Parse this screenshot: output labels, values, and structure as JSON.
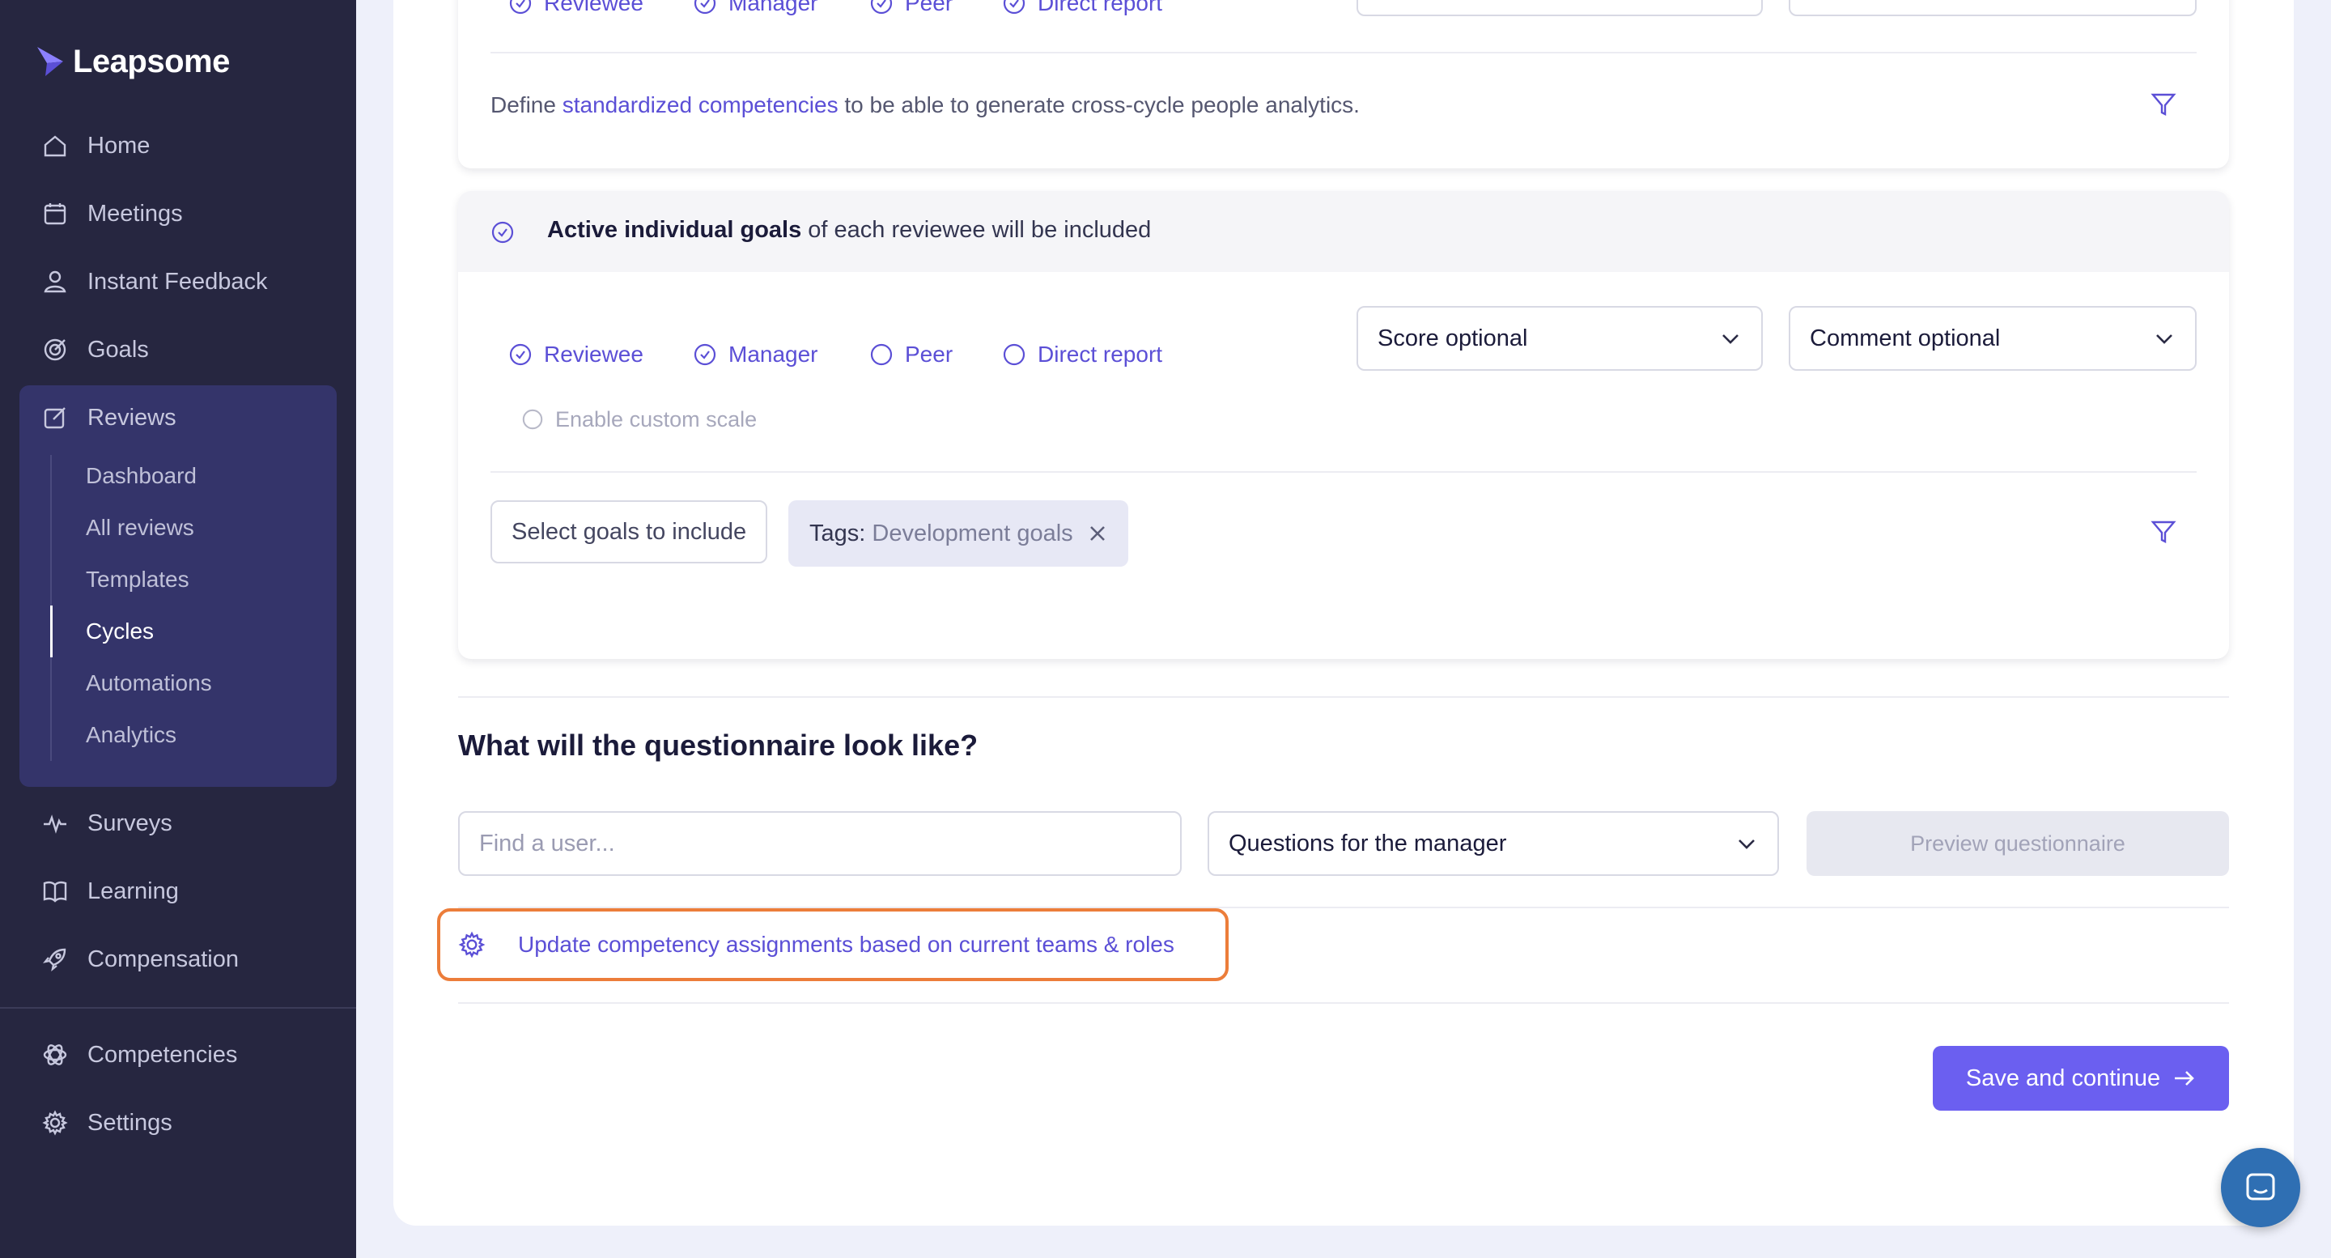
{
  "app": {
    "name": "Leapsome"
  },
  "sidebar": {
    "items": [
      {
        "label": "Home",
        "icon": "home-icon"
      },
      {
        "label": "Meetings",
        "icon": "meetings-icon"
      },
      {
        "label": "Instant Feedback",
        "icon": "feedback-icon"
      },
      {
        "label": "Goals",
        "icon": "target-icon"
      },
      {
        "label": "Reviews",
        "icon": "edit-icon"
      },
      {
        "label": "Surveys",
        "icon": "pulse-icon"
      },
      {
        "label": "Learning",
        "icon": "book-icon"
      },
      {
        "label": "Compensation",
        "icon": "rocket-icon"
      },
      {
        "label": "Competencies",
        "icon": "atom-icon"
      },
      {
        "label": "Settings",
        "icon": "gear-icon"
      }
    ],
    "reviews_sub": [
      "Dashboard",
      "All reviews",
      "Templates",
      "Cycles",
      "Automations",
      "Analytics"
    ],
    "active_sub": "Cycles"
  },
  "competencies_section": {
    "roles": [
      "Reviewee",
      "Manager",
      "Peer",
      "Direct report"
    ],
    "define_prefix": "Define ",
    "define_link": "standardized competencies",
    "define_suffix": " to be able to generate cross-cycle people analytics."
  },
  "goals_section": {
    "title_bold": "Active individual goals",
    "title_rest": " of each reviewee will be included",
    "roles": [
      {
        "label": "Reviewee",
        "checked": true
      },
      {
        "label": "Manager",
        "checked": true
      },
      {
        "label": "Peer",
        "checked": false
      },
      {
        "label": "Direct report",
        "checked": false
      }
    ],
    "score_dropdown": "Score optional",
    "comment_dropdown": "Comment optional",
    "custom_scale": "Enable custom scale",
    "select_goals_button": "Select goals to include",
    "tag_key": "Tags:",
    "tag_value": "Development goals"
  },
  "questionnaire": {
    "heading": "What will the questionnaire look like?",
    "user_placeholder": "Find a user...",
    "questions_dropdown": "Questions for the manager",
    "preview_button": "Preview questionnaire",
    "update_link": "Update competency assignments based on current teams & roles"
  },
  "footer": {
    "save_button": "Save and continue"
  },
  "colors": {
    "accent": "#6b5ff0",
    "sidebar_bg": "#262640",
    "highlight": "#ec7d3a"
  }
}
